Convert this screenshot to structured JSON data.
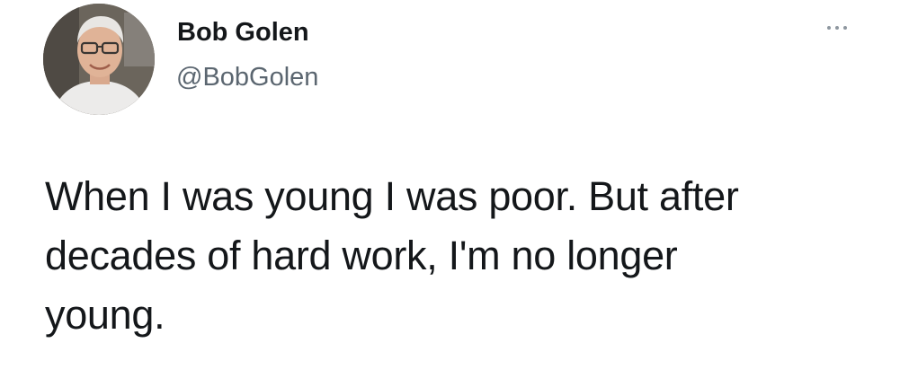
{
  "author": {
    "display_name": "Bob Golen",
    "handle": "@BobGolen"
  },
  "menu": {
    "icon": "more-horizontal-icon"
  },
  "tweet": {
    "lines": [
      "When I was young I was poor.  But after",
      "decades of hard work, I'm no longer",
      "young."
    ]
  },
  "colors": {
    "text": "#14171a",
    "secondary_text": "#5b6670",
    "icon_gray": "#8e979f",
    "background": "#ffffff"
  }
}
